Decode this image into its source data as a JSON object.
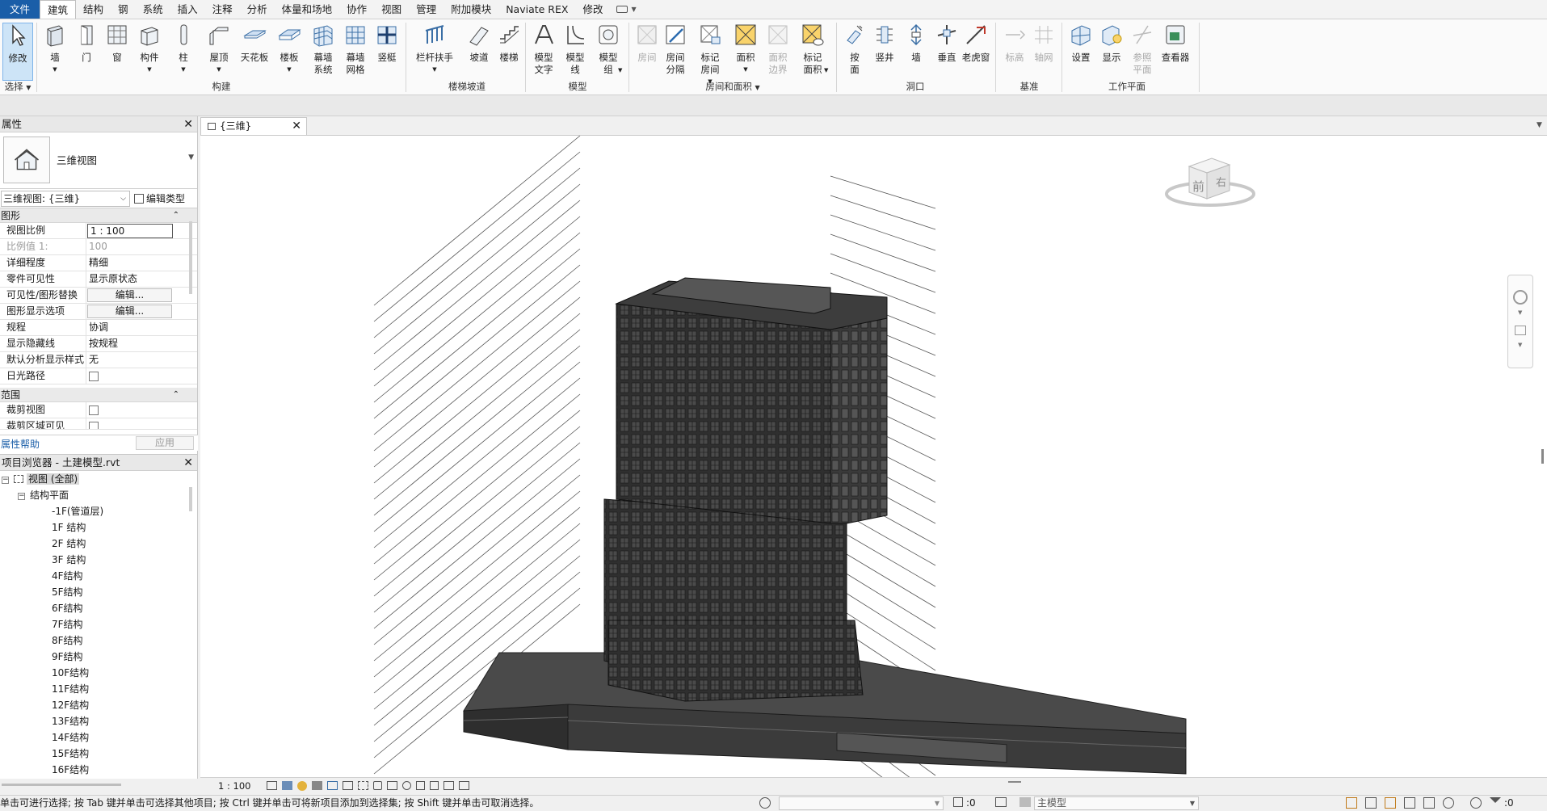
{
  "menu": {
    "file": "文件",
    "tabs": [
      "建筑",
      "结构",
      "钢",
      "系统",
      "插入",
      "注释",
      "分析",
      "体量和场地",
      "协作",
      "视图",
      "管理",
      "附加模块",
      "Naviate REX",
      "修改"
    ]
  },
  "ribbon": {
    "select": {
      "modify": "修改",
      "panel": "选择"
    },
    "build": {
      "wall": "墙",
      "door": "门",
      "window": "窗",
      "component": "构件",
      "column": "柱",
      "roof": "屋顶",
      "ceiling": "天花板",
      "floor": "楼板",
      "curtain_system": "幕墙系统",
      "curtain_grid": "幕墙网格",
      "mullion": "竖梃",
      "panel": "构建"
    },
    "circulation": {
      "railing": "栏杆扶手",
      "ramp": "坡道",
      "stair": "楼梯",
      "panel": "楼梯坡道"
    },
    "model": {
      "model_text": "模型文字",
      "model_line": "模型线",
      "model_group": "模型组",
      "panel": "模型"
    },
    "room": {
      "room": "房间",
      "room_sep": "房间分隔",
      "tag_room": "标记房间",
      "area": "面积",
      "area_boundary": "面积边界",
      "tag_area": "标记面积",
      "panel": "房间和面积"
    },
    "opening": {
      "by_face": "按面",
      "shaft": "竖井",
      "wall": "墙",
      "vertical": "垂直",
      "dormer": "老虎窗",
      "panel": "洞口"
    },
    "datum": {
      "level": "标高",
      "grid": "轴网",
      "panel": "基准"
    },
    "workplane": {
      "set": "设置",
      "show": "显示",
      "ref_plane": "参照平面",
      "viewer": "查看器",
      "panel": "工作平面"
    }
  },
  "properties": {
    "title": "属性",
    "type_name": "三维视图",
    "view_selector": "三维视图: {三维}",
    "edit_type": "编辑类型",
    "group_graphics": "图形",
    "rows": [
      {
        "key": "视图比例",
        "value": "1 : 100"
      },
      {
        "key": "比例值 1:",
        "value": "100"
      },
      {
        "key": "详细程度",
        "value": "精细"
      },
      {
        "key": "零件可见性",
        "value": "显示原状态"
      },
      {
        "key": "可见性/图形替换",
        "value": "编辑..."
      },
      {
        "key": "图形显示选项",
        "value": "编辑..."
      },
      {
        "key": "规程",
        "value": "协调"
      },
      {
        "key": "显示隐藏线",
        "value": "按规程"
      },
      {
        "key": "默认分析显示样式",
        "value": "无"
      },
      {
        "key": "日光路径",
        "value": ""
      }
    ],
    "group_extents": "范围",
    "extent_rows": [
      {
        "key": "裁剪视图"
      },
      {
        "key": "裁剪区域可见"
      }
    ],
    "help": "属性帮助",
    "apply": "应用"
  },
  "browser": {
    "title": "项目浏览器 - 土建模型.rvt",
    "root": "视图 (全部)",
    "group": "结构平面",
    "items": [
      "-1F(管道层)",
      "1F 结构",
      "2F 结构",
      "3F 结构",
      "4F结构",
      "5F结构",
      "6F结构",
      "7F结构",
      "8F结构",
      "9F结构",
      "10F结构",
      "11F结构",
      "12F结构",
      "13F结构",
      "14F结构",
      "15F结构",
      "16F结构"
    ]
  },
  "view": {
    "tab": "{三维}",
    "viewcube_front": "前",
    "viewcube_right": "右"
  },
  "viewbar": {
    "scale": "1 : 100"
  },
  "status": {
    "message": "单击可进行选择; 按 Tab 键并单击可选择其他项目; 按 Ctrl 键并单击可将新项目添加到选择集; 按 Shift 键并单击可取消选择。",
    "workset_count": ":0",
    "model": "主模型",
    "filter_count": ":0"
  }
}
